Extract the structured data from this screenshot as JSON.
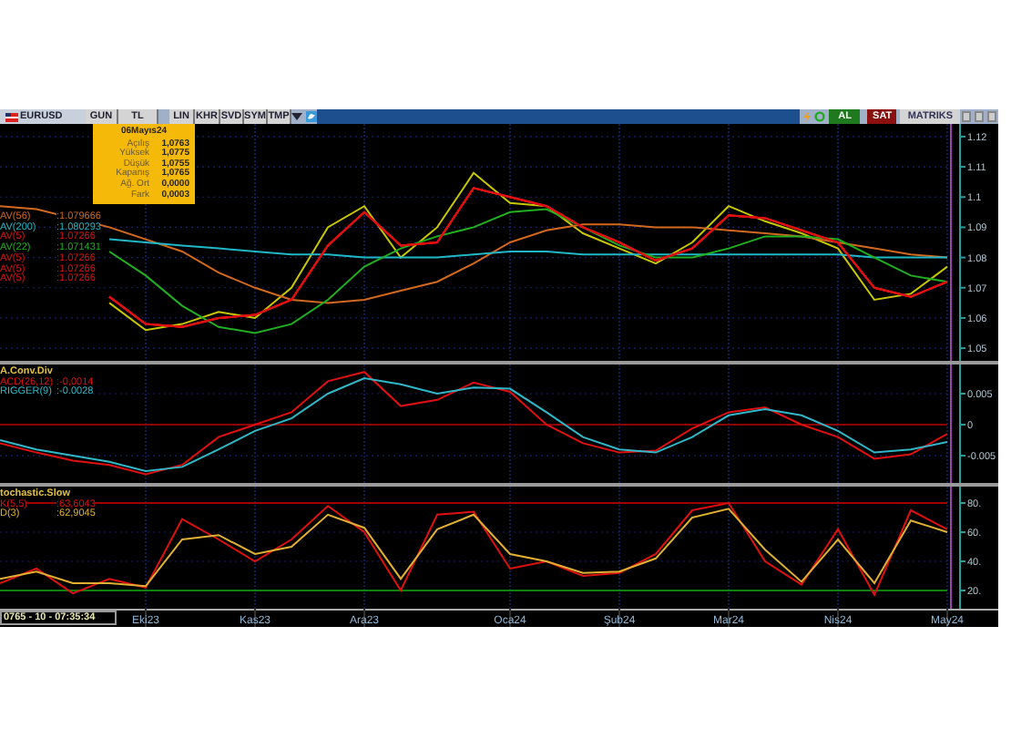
{
  "toolbar": {
    "symbol": "EURUSD",
    "buttons": [
      {
        "label": "GUN"
      },
      {
        "label": "TL"
      },
      {
        "label": "LIN"
      },
      {
        "label": "KHR"
      },
      {
        "label": "SVD"
      },
      {
        "label": "SYM"
      },
      {
        "label": "TMP"
      }
    ],
    "buy": "AL",
    "sell": "SAT",
    "brand": "MATRIKS"
  },
  "info_box": {
    "date": "06Mayıs24",
    "rows": [
      {
        "label": "Açılış",
        "value": "1,0763"
      },
      {
        "label": "Yüksek",
        "value": "1,0775"
      },
      {
        "label": "Düşük",
        "value": "1,0755"
      },
      {
        "label": "Kapanış",
        "value": "1,0765"
      },
      {
        "label": "Ağ. Ort",
        "value": "0,0000"
      },
      {
        "label": "Fark",
        "value": "0,0003"
      }
    ]
  },
  "panels": [
    {
      "legend_values": [
        ":1.079666",
        ":1.080293",
        ":1.07266",
        ":1.071431",
        ":1.07266",
        ":1.07266",
        ":1.07266"
      ],
      "chart_data": {
        "type": "line",
        "grid": true,
        "categories": [
          null,
          null,
          null,
          null,
          null,
          null,
          null,
          null,
          null,
          null,
          null,
          null,
          null,
          null,
          null,
          null,
          null,
          null,
          null,
          null,
          null,
          null,
          null,
          null,
          null,
          null,
          null
        ],
        "ylim": [
          1.0458,
          1.1242
        ],
        "yticks": [
          {
            "value": 1.05,
            "label": "1.05"
          },
          {
            "value": 1.06,
            "label": "1.06"
          },
          {
            "value": 1.07,
            "label": "1.07"
          },
          {
            "value": 1.08,
            "label": "1.08"
          },
          {
            "value": 1.09,
            "label": "1.09"
          },
          {
            "value": 1.1,
            "label": "1.1"
          },
          {
            "value": 1.11,
            "label": "1.11"
          },
          {
            "value": 1.12,
            "label": "1.12"
          }
        ],
        "series": [
          {
            "color": "#c8c800",
            "values": [
              null,
              null,
              null,
              1.065,
              1.056,
              1.058,
              1.062,
              1.06,
              1.07,
              1.09,
              1.097,
              1.08,
              1.09,
              1.108,
              1.098,
              1.097,
              1.088,
              1.083,
              1.078,
              1.085,
              1.097,
              1.092,
              1.088,
              1.083,
              1.066,
              1.068,
              1.077
            ]
          },
          {
            "name": "AV(56)",
            "color": "#d2691e",
            "values": [
              1.097,
              1.096,
              null,
              1.09,
              1.086,
              1.082,
              1.075,
              1.07,
              1.066,
              1.065,
              1.066,
              1.069,
              1.072,
              1.078,
              1.085,
              1.089,
              1.091,
              1.091,
              1.09,
              1.09,
              1.089,
              1.088,
              1.087,
              1.085,
              1.083,
              1.081,
              1.08
            ]
          },
          {
            "name": "AV(200)",
            "color": "#20b8c8",
            "values": [
              null,
              null,
              null,
              1.086,
              1.085,
              1.084,
              1.083,
              1.082,
              1.081,
              1.081,
              1.08,
              1.08,
              1.08,
              1.081,
              1.082,
              1.082,
              1.081,
              1.081,
              1.081,
              1.081,
              1.081,
              1.081,
              1.081,
              1.081,
              1.08,
              1.08,
              1.08
            ]
          },
          {
            "name": "AV(5)",
            "color": "#e01010",
            "values": [
              null,
              null,
              null,
              1.067,
              1.058,
              1.057,
              1.06,
              1.061,
              1.066,
              1.084,
              1.095,
              1.084,
              1.085,
              1.103,
              1.1,
              1.097,
              1.09,
              1.085,
              1.079,
              1.083,
              1.094,
              1.093,
              1.089,
              1.085,
              1.07,
              1.067,
              1.072
            ]
          },
          {
            "name": "AV(22)",
            "color": "#20b020",
            "values": [
              null,
              null,
              null,
              1.082,
              1.074,
              1.064,
              1.057,
              1.055,
              1.058,
              1.066,
              1.077,
              1.083,
              1.087,
              1.09,
              1.095,
              1.096,
              1.09,
              1.084,
              1.08,
              1.08,
              1.083,
              1.087,
              1.087,
              1.086,
              1.08,
              1.074,
              1.072
            ]
          },
          {
            "name": "AV(5)",
            "color": "#e01010",
            "values": [
              null,
              null,
              null,
              1.067,
              1.058,
              1.057,
              1.06,
              1.061,
              1.066,
              1.084,
              1.095,
              1.084,
              1.085,
              1.103,
              1.1,
              1.097,
              1.09,
              1.085,
              1.079,
              1.083,
              1.094,
              1.093,
              1.089,
              1.085,
              1.07,
              1.067,
              1.072
            ]
          },
          {
            "name": "AV(5)",
            "color": "#e01010",
            "values": [
              null,
              null,
              null,
              1.067,
              1.058,
              1.057,
              1.06,
              1.061,
              1.066,
              1.084,
              1.095,
              1.084,
              1.085,
              1.103,
              1.1,
              1.097,
              1.09,
              1.085,
              1.079,
              1.083,
              1.094,
              1.093,
              1.089,
              1.085,
              1.07,
              1.067,
              1.072
            ]
          },
          {
            "name": "AV(5)",
            "color": "#e01010",
            "values": [
              null,
              null,
              null,
              1.067,
              1.058,
              1.057,
              1.06,
              1.061,
              1.066,
              1.084,
              1.095,
              1.084,
              1.085,
              1.103,
              1.1,
              1.097,
              1.09,
              1.085,
              1.079,
              1.083,
              1.094,
              1.093,
              1.089,
              1.085,
              1.07,
              1.067,
              1.072
            ]
          }
        ]
      }
    },
    {
      "title": "A.Conv.Div",
      "legend_values": [
        ":-0,0014",
        ":-0.0028"
      ],
      "chart_data": {
        "type": "line",
        "grid": true,
        "categories": [
          null,
          null,
          null,
          null,
          null,
          null,
          null,
          null,
          null,
          null,
          null,
          null,
          null,
          null,
          null,
          null,
          null,
          null,
          null,
          null,
          null,
          null,
          null,
          null,
          null,
          null,
          null
        ],
        "ylim": [
          -0.0094,
          0.0097
        ],
        "yticks": [
          {
            "value": -0.005,
            "label": "-0.005"
          },
          {
            "value": 0,
            "label": "0"
          },
          {
            "value": 0.005,
            "label": "0.005"
          }
        ],
        "series": [
          {
            "color": "#900000",
            "values": [
              0,
              0,
              0,
              0,
              0,
              0,
              0,
              0,
              0,
              0,
              0,
              0,
              0,
              0,
              0,
              0,
              0,
              0,
              0,
              0,
              0,
              0,
              0,
              0,
              0,
              0,
              0
            ]
          },
          {
            "name": "ACD(26,12)",
            "color": "#e01010",
            "values": [
              -0.003,
              -0.0045,
              -0.0058,
              -0.0065,
              -0.008,
              -0.0065,
              -0.002,
              0,
              0.002,
              0.007,
              0.0085,
              0.003,
              0.004,
              0.0068,
              0.0053,
              0,
              -0.003,
              -0.0045,
              -0.0042,
              -0.0006,
              0.002,
              0.0028,
              0,
              -0.002,
              -0.0055,
              -0.0048,
              -0.0015
            ]
          },
          {
            "name": "RIGGER(9)",
            "color": "#30b8c8",
            "values": [
              -0.0025,
              -0.004,
              -0.005,
              -0.006,
              -0.0075,
              -0.0068,
              -0.004,
              -0.001,
              0.001,
              0.005,
              0.0075,
              0.0065,
              0.005,
              0.006,
              0.0058,
              0.002,
              -0.002,
              -0.004,
              -0.0045,
              -0.002,
              0.0015,
              0.0025,
              0.0015,
              -0.001,
              -0.0045,
              -0.004,
              -0.0028
            ]
          }
        ]
      }
    },
    {
      "title": "tochastic.Slow",
      "legend_values": [
        ":63,6043",
        ":62,9045"
      ],
      "chart_data": {
        "type": "line",
        "grid": true,
        "categories": [
          null,
          null,
          null,
          null,
          "Eki23",
          null,
          null,
          "Kas23",
          null,
          null,
          "Ara23",
          null,
          null,
          null,
          "Oca24",
          null,
          null,
          "Şub24",
          null,
          null,
          "Mar24",
          null,
          null,
          "Nis24",
          null,
          null,
          "May24"
        ],
        "ylim": [
          7.5,
          91.25
        ],
        "yticks": [
          {
            "value": 20,
            "label": "20."
          },
          {
            "value": 40,
            "label": "40."
          },
          {
            "value": 60,
            "label": "60."
          },
          {
            "value": 80,
            "label": "80."
          }
        ],
        "series": [
          {
            "color": "#a00000",
            "values": [
              80,
              80,
              80,
              80,
              80,
              80,
              80,
              80,
              80,
              80,
              80,
              80,
              80,
              80,
              80,
              80,
              80,
              80,
              80,
              80,
              80,
              80,
              80,
              80,
              80,
              80,
              80
            ]
          },
          {
            "color": "#108010",
            "values": [
              20,
              20,
              20,
              20,
              20,
              20,
              20,
              20,
              20,
              20,
              20,
              20,
              20,
              20,
              20,
              20,
              20,
              20,
              20,
              20,
              20,
              20,
              20,
              20,
              20,
              20,
              20
            ]
          },
          {
            "name": "K(5,5)",
            "color": "#e01010",
            "values": [
              25,
              35,
              18,
              28,
              22,
              69,
              55,
              40,
              55,
              78,
              60,
              20,
              72,
              74,
              35,
              40,
              30,
              32,
              45,
              75,
              80,
              40,
              24,
              62,
              17,
              75,
              62
            ]
          },
          {
            "name": "D(3)",
            "color": "#e0b030",
            "values": [
              28,
              33,
              25,
              25,
              23,
              55,
              58,
              45,
              50,
              72,
              63,
              28,
              62,
              72,
              45,
              40,
              32,
              33,
              42,
              70,
              76,
              48,
              26,
              55,
              25,
              68,
              60
            ]
          }
        ]
      }
    }
  ],
  "status": "0765 - 10 - 07:35:34"
}
